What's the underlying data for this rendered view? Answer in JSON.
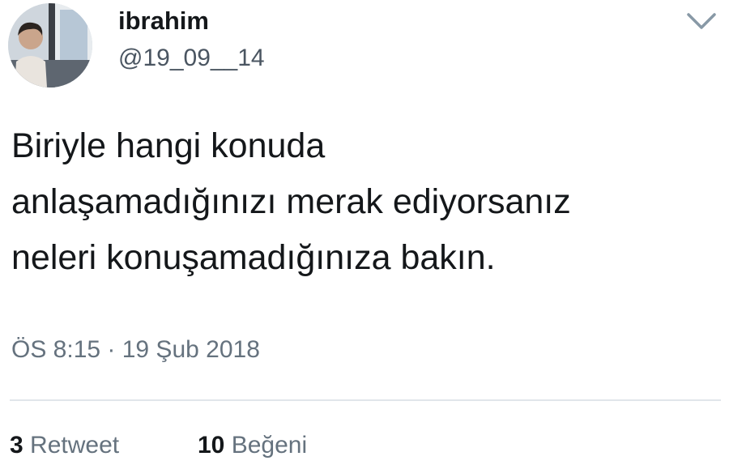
{
  "tweet": {
    "author": {
      "display_name": "ibrahim",
      "handle": "@19_09__14",
      "avatar_icon": "user-avatar-photo"
    },
    "menu_icon": "chevron-down-icon",
    "text": "Biriyle hangi konuda\nanlaşamadığınızı merak ediyorsanız\nneleri konuşamadığınıza bakın.",
    "timestamp": "ÖS 8:15 · 19 Şub 2018",
    "stats": {
      "retweets": {
        "count": "3",
        "label": "Retweet"
      },
      "likes": {
        "count": "10",
        "label": "Beğeni"
      }
    }
  },
  "colors": {
    "text_primary": "#14171a",
    "text_secondary": "#65727e",
    "divider": "#e1e6ea"
  }
}
